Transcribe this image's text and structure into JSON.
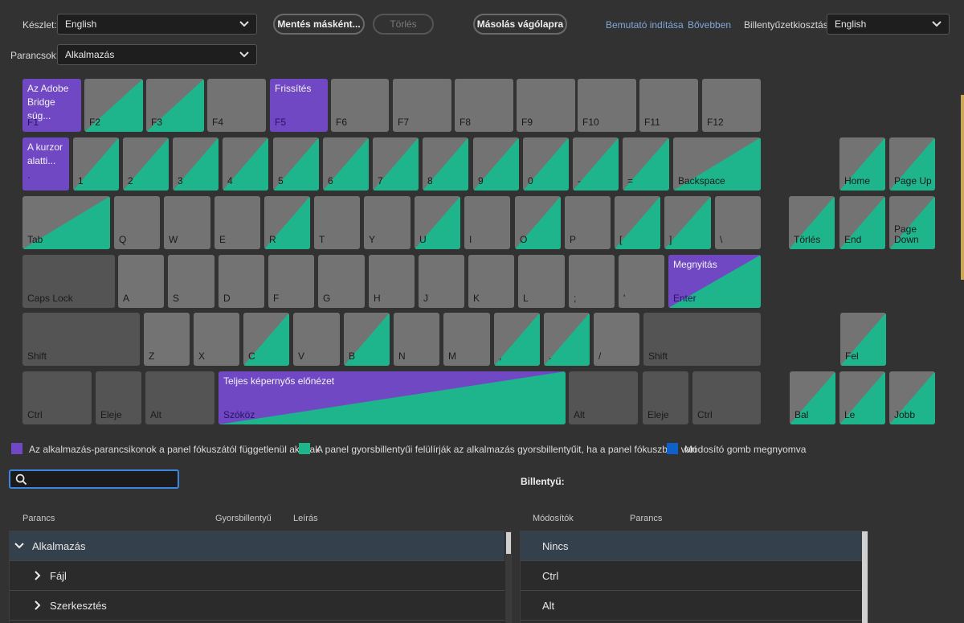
{
  "toolbar": {
    "set_label": "Készlet:",
    "set_value": "English",
    "commands_label": "Parancsok:",
    "commands_value": "Alkalmazás",
    "save_as": "Mentés másként...",
    "delete": "Törlés",
    "copy_clipboard": "Másolás vágólapra",
    "start_tour": "Bemutató indítása",
    "learn_more": "Bővebben",
    "layout_label": "Billentyűzetkiosztás:",
    "layout_value": "English"
  },
  "colors": {
    "app_command": "#7148c4",
    "panel_override": "#1fb58c",
    "modifier": "#1060cc",
    "key_default": "#737373",
    "key_modifier": "#545454"
  },
  "keyboard": {
    "keys": [
      {
        "id": "f1",
        "name": "F1",
        "cmd": "Az Adobe Bridge súg...",
        "type": "app"
      },
      {
        "id": "f2",
        "name": "F2",
        "type": "panel"
      },
      {
        "id": "f3",
        "name": "F3",
        "type": "panel"
      },
      {
        "id": "f4",
        "name": "F4",
        "type": "none"
      },
      {
        "id": "f5",
        "name": "F5",
        "cmd": "Frissítés",
        "type": "app"
      },
      {
        "id": "f6",
        "name": "F6",
        "type": "none"
      },
      {
        "id": "f7",
        "name": "F7",
        "type": "none"
      },
      {
        "id": "f8",
        "name": "F8",
        "type": "none"
      },
      {
        "id": "f9",
        "name": "F9",
        "type": "none"
      },
      {
        "id": "f10",
        "name": "F10",
        "type": "none"
      },
      {
        "id": "f11",
        "name": "F11",
        "type": "none"
      },
      {
        "id": "f12",
        "name": "F12",
        "type": "none"
      },
      {
        "id": "backtick",
        "name": "`",
        "cmd": "A kurzor alatti...",
        "type": "app"
      },
      {
        "id": "k1",
        "name": "1",
        "type": "panel"
      },
      {
        "id": "k2",
        "name": "2",
        "type": "panel"
      },
      {
        "id": "k3",
        "name": "3",
        "type": "panel"
      },
      {
        "id": "k4",
        "name": "4",
        "type": "panel"
      },
      {
        "id": "k5",
        "name": "5",
        "type": "panel"
      },
      {
        "id": "k6",
        "name": "6",
        "type": "panel"
      },
      {
        "id": "k7",
        "name": "7",
        "type": "panel"
      },
      {
        "id": "k8",
        "name": "8",
        "type": "panel"
      },
      {
        "id": "k9",
        "name": "9",
        "type": "panel"
      },
      {
        "id": "k0",
        "name": "0",
        "type": "panel"
      },
      {
        "id": "minus",
        "name": "-",
        "type": "panel"
      },
      {
        "id": "equals",
        "name": "=",
        "type": "panel"
      },
      {
        "id": "backspace",
        "name": "Backspace",
        "type": "panel"
      },
      {
        "id": "home",
        "name": "Home",
        "type": "panel"
      },
      {
        "id": "pageup",
        "name": "Page Up",
        "type": "panel"
      },
      {
        "id": "tab",
        "name": "Tab",
        "type": "panel"
      },
      {
        "id": "q",
        "name": "Q",
        "type": "none"
      },
      {
        "id": "w",
        "name": "W",
        "type": "none"
      },
      {
        "id": "e",
        "name": "E",
        "type": "none"
      },
      {
        "id": "r",
        "name": "R",
        "type": "panel"
      },
      {
        "id": "t",
        "name": "T",
        "type": "none"
      },
      {
        "id": "y",
        "name": "Y",
        "type": "none"
      },
      {
        "id": "u",
        "name": "U",
        "type": "panel"
      },
      {
        "id": "i",
        "name": "I",
        "type": "none"
      },
      {
        "id": "o",
        "name": "O",
        "type": "panel"
      },
      {
        "id": "p",
        "name": "P",
        "type": "none"
      },
      {
        "id": "lbracket",
        "name": "[",
        "type": "panel"
      },
      {
        "id": "rbracket",
        "name": "]",
        "type": "panel"
      },
      {
        "id": "backslash",
        "name": "\\",
        "type": "none"
      },
      {
        "id": "delete",
        "name": "Törlés",
        "type": "panel"
      },
      {
        "id": "end",
        "name": "End",
        "type": "panel"
      },
      {
        "id": "pagedown",
        "name": "Page Down",
        "type": "panel"
      },
      {
        "id": "capslock",
        "name": "Caps Lock",
        "type": "modifier"
      },
      {
        "id": "a",
        "name": "A",
        "type": "none"
      },
      {
        "id": "s",
        "name": "S",
        "type": "none"
      },
      {
        "id": "d",
        "name": "D",
        "type": "none"
      },
      {
        "id": "f",
        "name": "F",
        "type": "none"
      },
      {
        "id": "g",
        "name": "G",
        "type": "none"
      },
      {
        "id": "h",
        "name": "H",
        "type": "none"
      },
      {
        "id": "j",
        "name": "J",
        "type": "none"
      },
      {
        "id": "k",
        "name": "K",
        "type": "none"
      },
      {
        "id": "l",
        "name": "L",
        "type": "none"
      },
      {
        "id": "semicolon",
        "name": ";",
        "type": "none"
      },
      {
        "id": "quote",
        "name": "'",
        "type": "none"
      },
      {
        "id": "enter",
        "name": "Enter",
        "cmd": "Megnyitás",
        "type": "both"
      },
      {
        "id": "lshift",
        "name": "Shift",
        "type": "modifier"
      },
      {
        "id": "z",
        "name": "Z",
        "type": "none"
      },
      {
        "id": "x",
        "name": "X",
        "type": "none"
      },
      {
        "id": "c",
        "name": "C",
        "type": "panel"
      },
      {
        "id": "v",
        "name": "V",
        "type": "none"
      },
      {
        "id": "b",
        "name": "B",
        "type": "panel"
      },
      {
        "id": "n",
        "name": "N",
        "type": "none"
      },
      {
        "id": "m",
        "name": "M",
        "type": "none"
      },
      {
        "id": "comma",
        "name": ",",
        "type": "panel"
      },
      {
        "id": "period",
        "name": ".",
        "type": "panel"
      },
      {
        "id": "slash",
        "name": "/",
        "type": "none"
      },
      {
        "id": "rshift",
        "name": "Shift",
        "type": "modifier"
      },
      {
        "id": "up",
        "name": "Fel",
        "type": "panel"
      },
      {
        "id": "lctrl",
        "name": "Ctrl",
        "type": "modifier"
      },
      {
        "id": "lwin",
        "name": "Eleje",
        "type": "modifier"
      },
      {
        "id": "lalt",
        "name": "Alt",
        "type": "modifier"
      },
      {
        "id": "space",
        "name": "Szóköz",
        "cmd": "Teljes képernyős előnézet",
        "type": "both"
      },
      {
        "id": "ralt",
        "name": "Alt",
        "type": "modifier"
      },
      {
        "id": "rwin",
        "name": "Eleje",
        "type": "modifier"
      },
      {
        "id": "rctrl",
        "name": "Ctrl",
        "type": "modifier"
      },
      {
        "id": "left",
        "name": "Bal",
        "type": "panel"
      },
      {
        "id": "down",
        "name": "Le",
        "type": "panel"
      },
      {
        "id": "right",
        "name": "Jobb",
        "type": "panel"
      }
    ]
  },
  "legend": {
    "app": "Az alkalmazás-parancsikonok a panel fókuszától függetlenül aktívak",
    "panel": "A panel gyorsbillentyűi felülírják az alkalmazás gyorsbillentyűit, ha a panel fókuszban van",
    "modifier": "Módosító gomb megnyomva"
  },
  "search": {
    "placeholder": "",
    "value": ""
  },
  "key_panel": {
    "title": "Billentyű:"
  },
  "commands_table": {
    "headers": [
      "Parancs",
      "Gyorsbillentyű",
      "Leírás"
    ],
    "rows": [
      {
        "label": "Alkalmazás",
        "expanded": true,
        "level": 0
      },
      {
        "label": "Fájl",
        "expanded": false,
        "level": 1
      },
      {
        "label": "Szerkesztés",
        "expanded": false,
        "level": 1
      }
    ]
  },
  "modifiers_table": {
    "headers": [
      "Módosítók",
      "Parancs"
    ],
    "rows": [
      {
        "label": "Nincs"
      },
      {
        "label": "Ctrl"
      },
      {
        "label": "Alt"
      }
    ]
  }
}
